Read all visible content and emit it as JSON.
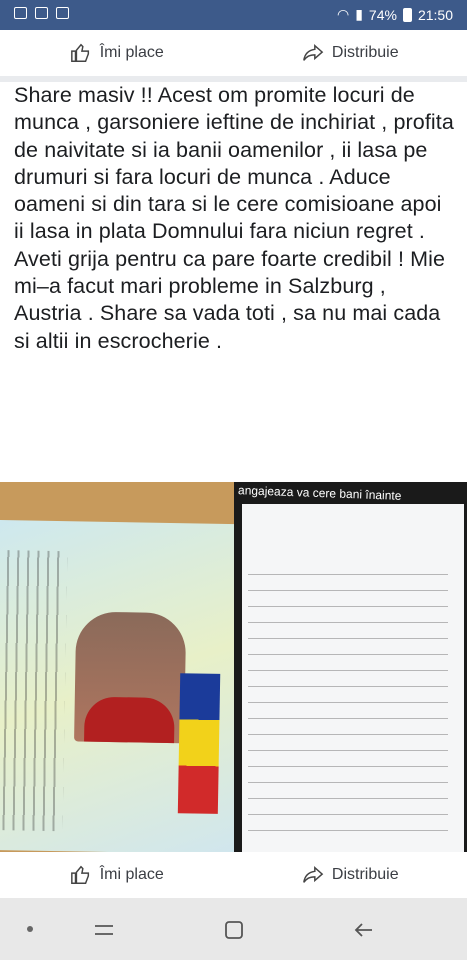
{
  "status": {
    "battery": "74%",
    "time": "21:50"
  },
  "actions_top": {
    "like": "Îmi place",
    "share": "Distribuie"
  },
  "post": {
    "text": "Share masiv !! Acest om promite locuri de munca , garsoniere ieftine de inchiriat , profita de naivitate si ia banii oamenilor , ii lasa pe drumuri si fara locuri de munca . Aduce oameni si din tara si le cere comisioane apoi ii lasa in plata Domnului fara niciun regret . Aveti grija pentru ca pare foarte credibil ! Mie mi–a facut mari probleme in Salzburg , Austria . Share sa vada toti , sa nu mai cada si altii in escrocherie ."
  },
  "photo": {
    "phone_caption": "angajeaza va cere bani înainte"
  },
  "actions_bottom": {
    "like": "Îmi place",
    "share": "Distribuie"
  },
  "icons": [
    "image-icon",
    "gmail-icon",
    "check-icon",
    "wifi-icon",
    "signal-icon",
    "battery-icon",
    "like-icon",
    "share-icon",
    "recents-icon",
    "home-icon",
    "back-icon"
  ]
}
